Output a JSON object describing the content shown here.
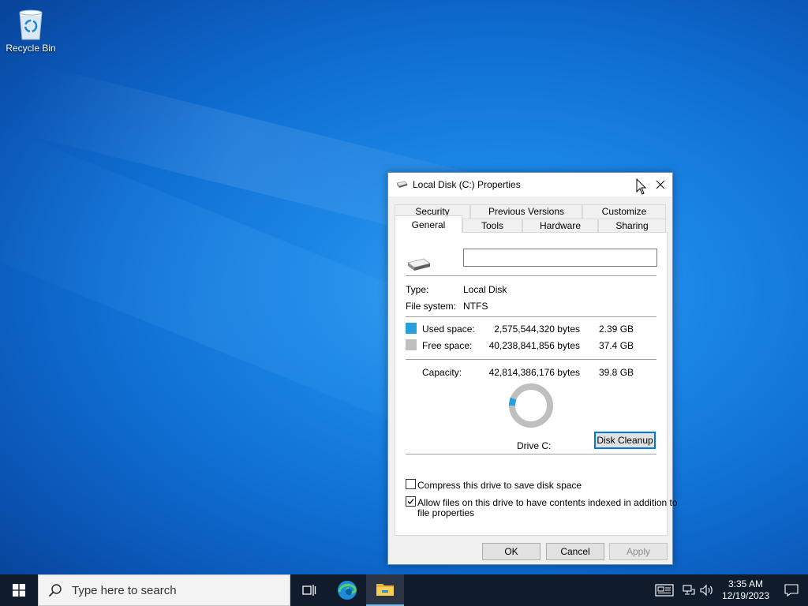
{
  "desktop": {
    "recycle_bin_label": "Recycle Bin"
  },
  "dialog": {
    "title": "Local Disk (C:) Properties",
    "tabs_row1": [
      "Security",
      "Previous Versions",
      "Customize"
    ],
    "tabs_row2": [
      "General",
      "Tools",
      "Hardware",
      "Sharing"
    ],
    "active_tab": "General",
    "name_value": "",
    "type_label": "Type:",
    "type_value": "Local Disk",
    "fs_label": "File system:",
    "fs_value": "NTFS",
    "used_label": "Used space:",
    "used_bytes": "2,575,544,320 bytes",
    "used_gb": "2.39 GB",
    "free_label": "Free space:",
    "free_bytes": "40,238,841,856 bytes",
    "free_gb": "37.4 GB",
    "capacity_label": "Capacity:",
    "capacity_bytes": "42,814,386,176 bytes",
    "capacity_gb": "39.8 GB",
    "used_fraction": 0.06,
    "drive_label": "Drive C:",
    "cleanup_button": "Disk Cleanup",
    "compress_label": "Compress this drive to save disk space",
    "compress_checked": false,
    "index_label_line1": "Allow files on this drive to have contents indexed in addition to",
    "index_label_line2": "file properties",
    "index_checked": true,
    "ok_button": "OK",
    "cancel_button": "Cancel",
    "apply_button": "Apply",
    "colors": {
      "used": "#26a0da",
      "free": "#bfbfbf"
    }
  },
  "taskbar": {
    "search_placeholder": "Type here to search",
    "time": "3:35 AM",
    "date": "12/19/2023"
  }
}
